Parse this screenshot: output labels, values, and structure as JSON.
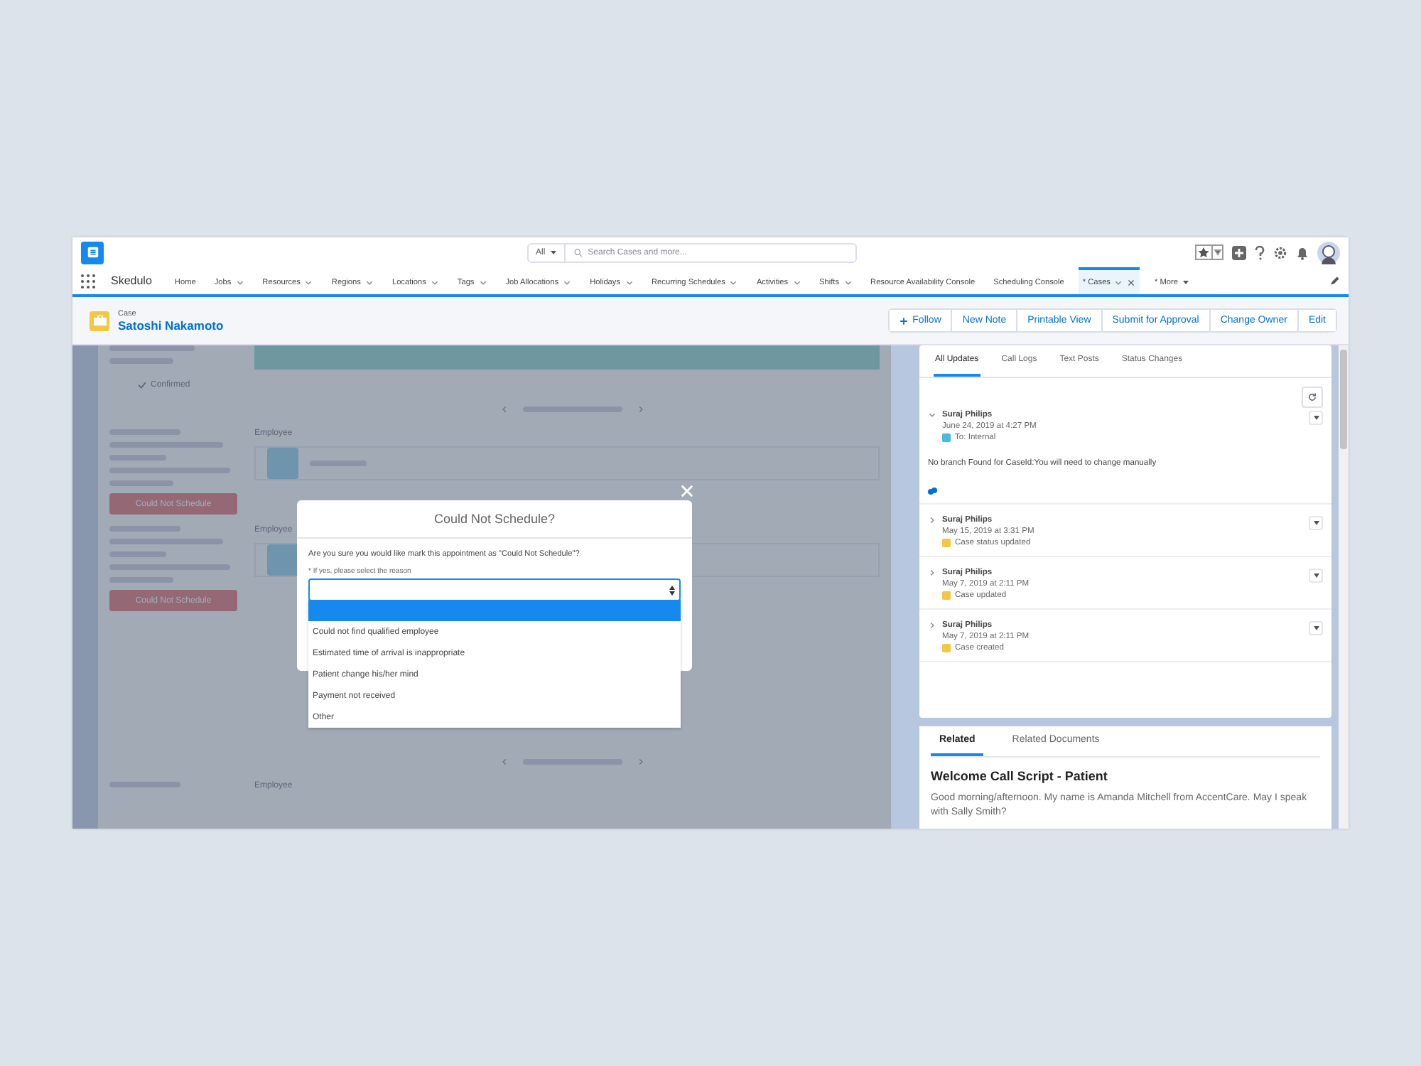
{
  "search": {
    "scope": "All",
    "placeholder": "Search Cases and more..."
  },
  "nav": {
    "app_name": "Skedulo",
    "items": [
      {
        "label": "Home",
        "menu": false,
        "selected": false
      },
      {
        "label": "Jobs",
        "menu": true,
        "selected": false
      },
      {
        "label": "Resources",
        "menu": true,
        "selected": false
      },
      {
        "label": "Regions",
        "menu": true,
        "selected": false
      },
      {
        "label": "Locations",
        "menu": true,
        "selected": false
      },
      {
        "label": "Tags",
        "menu": true,
        "selected": false
      },
      {
        "label": "Job Allocations",
        "menu": true,
        "selected": false
      },
      {
        "label": "Holidays",
        "menu": true,
        "selected": false
      },
      {
        "label": "Recurring Schedules",
        "menu": true,
        "selected": false
      },
      {
        "label": "Activities",
        "menu": true,
        "selected": false
      },
      {
        "label": "Shifts",
        "menu": true,
        "selected": false
      },
      {
        "label": "Resource Availability Console",
        "menu": false,
        "selected": false
      },
      {
        "label": "Scheduling Console",
        "menu": false,
        "selected": false
      },
      {
        "label": "* Cases",
        "menu": true,
        "selected": true,
        "closable": true
      }
    ],
    "more": "* More"
  },
  "record": {
    "type": "Case",
    "name": "Satoshi Nakamoto",
    "actions": [
      "Follow",
      "New Note",
      "Printable View",
      "Submit for Approval",
      "Change Owner",
      "Edit"
    ]
  },
  "background": {
    "status": "Confirmed",
    "sections": [
      {
        "column": "Employee",
        "button": "Could Not Schedule"
      },
      {
        "column": "Employee",
        "button": "Could Not Schedule"
      }
    ],
    "last_column": "Employee"
  },
  "modal": {
    "title": "Could Not Schedule?",
    "question": "Are you sure you would like mark this appointment as \"Could Not Schedule\"?",
    "field_label": "* If yes, please select the reason",
    "blank_option_highlighted": true,
    "options": [
      "Could not find qualified employee",
      "Estimated time of arrival is inappropriate",
      "Patient change his/her mind",
      "Payment not received",
      "Other"
    ]
  },
  "feed": {
    "tabs": [
      {
        "label": "All Updates",
        "selected": true
      },
      {
        "label": "Call Logs",
        "selected": false
      },
      {
        "label": "Text Posts",
        "selected": false
      },
      {
        "label": "Status Changes",
        "selected": false
      }
    ],
    "items": [
      {
        "author": "Suraj Philips",
        "time": "June 24, 2019 at 4:27 PM",
        "color": "#4bb8e0",
        "text": "To: Internal",
        "expanded": true,
        "body": "No branch Found for CaseId:You will need to change manually"
      },
      {
        "author": "Suraj Philips",
        "time": "May 15, 2019 at 3:31 PM",
        "color": "#f2c744",
        "text": "Case status updated",
        "expanded": false
      },
      {
        "author": "Suraj Philips",
        "time": "May 7, 2019 at 2:11 PM",
        "color": "#f2c744",
        "text": "Case updated",
        "expanded": false
      },
      {
        "author": "Suraj Philips",
        "time": "May 7, 2019 at 2:11 PM",
        "color": "#f2c744",
        "text": "Case created",
        "expanded": false
      }
    ]
  },
  "related": {
    "tabs": [
      {
        "label": "Related",
        "selected": true
      },
      {
        "label": "Related Documents",
        "selected": false
      }
    ],
    "title": "Welcome Call Script - Patient",
    "text": "Good morning/afternoon. My name is Amanda Mitchell from AccentCare. May I speak with Sally Smith?"
  }
}
